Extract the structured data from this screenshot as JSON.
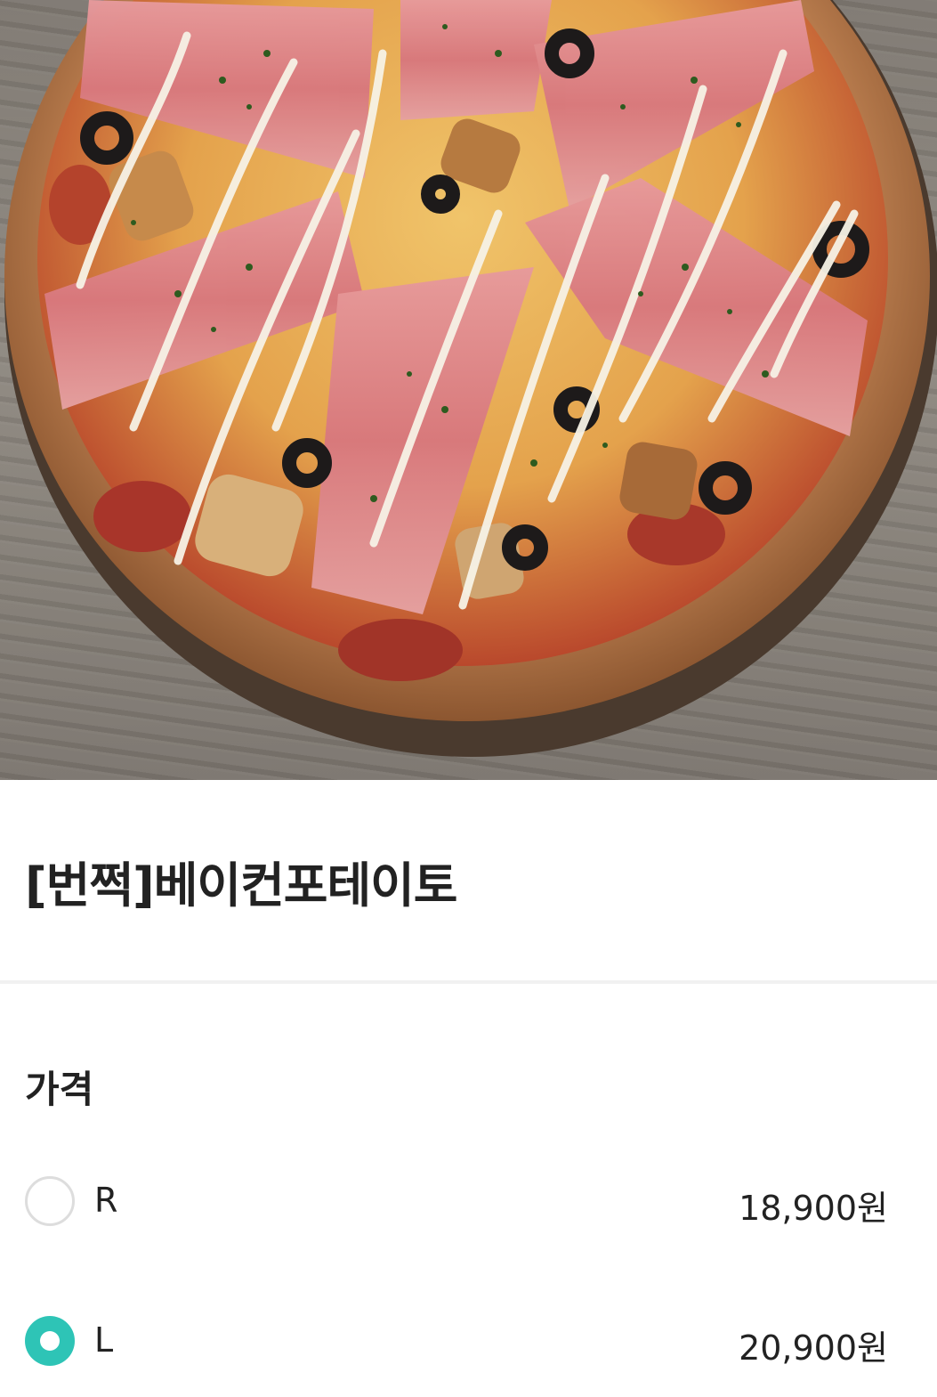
{
  "hero": {
    "image": "pizza-photo"
  },
  "product": {
    "title": "[번쩍]베이컨포테이토"
  },
  "price_section": {
    "label": "가격",
    "options": [
      {
        "size": "R",
        "price": "18,900원",
        "selected": false
      },
      {
        "size": "L",
        "price": "20,900원",
        "selected": true
      }
    ]
  },
  "colors": {
    "accent": "#2ec4b6",
    "text": "#222222",
    "radio_border": "#dddddd",
    "divider": "#f1f1f1"
  }
}
